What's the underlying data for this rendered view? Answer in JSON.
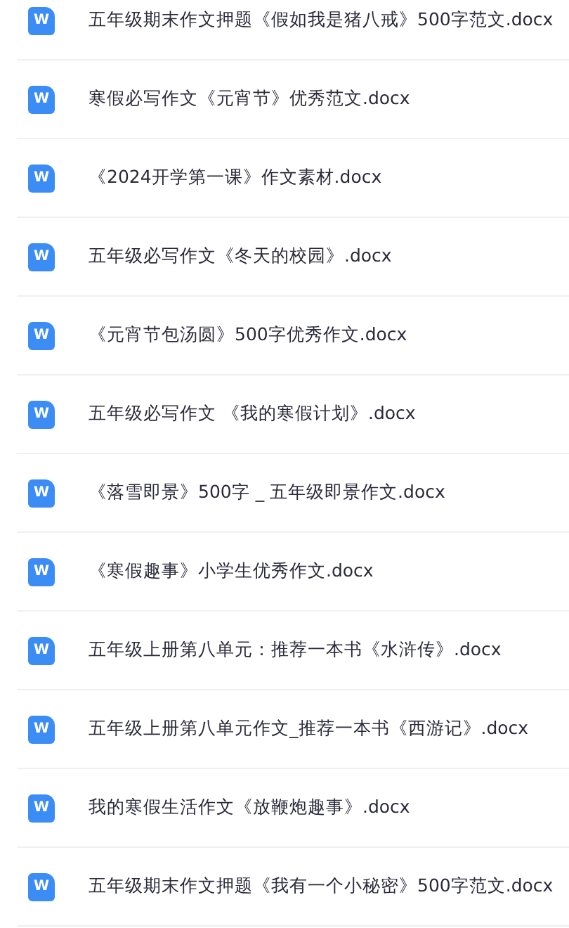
{
  "files": [
    {
      "icon_label": "W",
      "name": "五年级期末作文押题《假如我是猪八戒》500字范文.docx"
    },
    {
      "icon_label": "W",
      "name": "寒假必写作文《元宵节》优秀范文.docx"
    },
    {
      "icon_label": "W",
      "name": "《2024开学第一课》作文素材.docx"
    },
    {
      "icon_label": "W",
      "name": "五年级必写作文《冬天的校园》.docx"
    },
    {
      "icon_label": "W",
      "name": "《元宵节包汤圆》500字优秀作文.docx"
    },
    {
      "icon_label": "W",
      "name": "五年级必写作文 《我的寒假计划》.docx"
    },
    {
      "icon_label": "W",
      "name": "《落雪即景》500字 _ 五年级即景作文.docx"
    },
    {
      "icon_label": "W",
      "name": "《寒假趣事》小学生优秀作文.docx"
    },
    {
      "icon_label": "W",
      "name": "五年级上册第八单元：推荐一本书《水浒传》.docx"
    },
    {
      "icon_label": "W",
      "name": "五年级上册第八单元作文_推荐一本书《西游记》.docx"
    },
    {
      "icon_label": "W",
      "name": "我的寒假生活作文《放鞭炮趣事》.docx"
    },
    {
      "icon_label": "W",
      "name": "五年级期末作文押题《我有一个小秘密》500字范文.docx"
    }
  ]
}
